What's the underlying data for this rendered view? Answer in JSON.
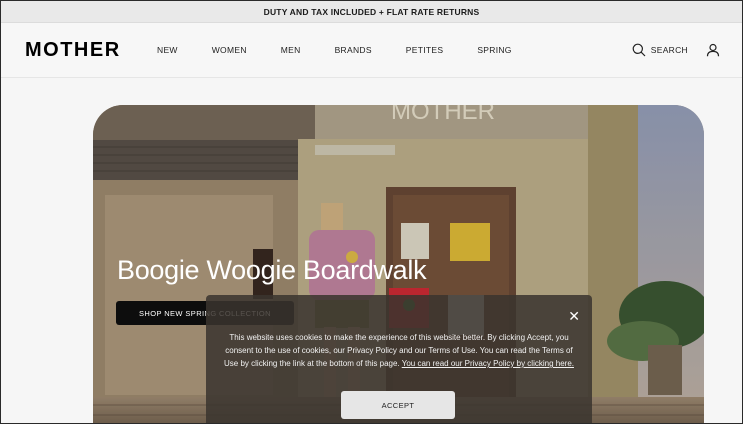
{
  "promo_banner": "DUTY AND TAX INCLUDED + FLAT RATE RETURNS",
  "header": {
    "logo": "MOTHER",
    "nav": [
      "NEW",
      "WOMEN",
      "MEN",
      "BRANDS",
      "PETITES",
      "SPRING"
    ],
    "search_label": "SEARCH"
  },
  "hero": {
    "title": "Boogie Woogie Boardwalk",
    "cta": "SHOP NEW SPRING COLLECTION",
    "sign_text": "MOTHER"
  },
  "cookie_banner": {
    "text_main": "This website uses cookies to make the experience of this website better. By clicking Accept, you consent to the use of cookies, our Privacy Policy and our Terms of Use. You can read the Terms of Use by clicking the link at the bottom of this page.",
    "text_link": "You can read our Privacy Policy by clicking here.",
    "accept_label": "ACCEPT",
    "close_icon": "close-icon"
  }
}
